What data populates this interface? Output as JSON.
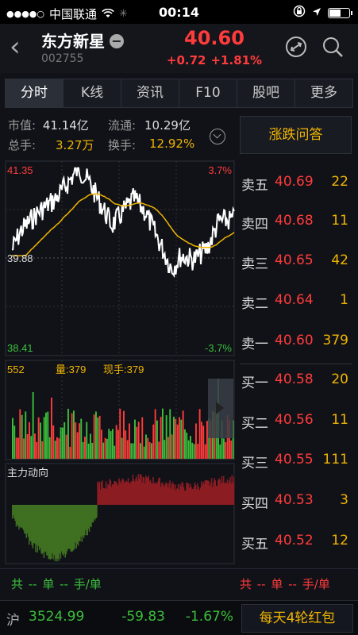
{
  "status": {
    "carrier": "中国联通",
    "time": "00:14"
  },
  "header": {
    "name": "东方新星",
    "code": "002755",
    "price": "40.60",
    "change": "+0.72",
    "change_pct": "+1.81%"
  },
  "tabs": [
    "分时",
    "K线",
    "资讯",
    "F10",
    "股吧",
    "更多"
  ],
  "info": {
    "mktcap_label": "市值:",
    "mktcap": "41.14亿",
    "float_label": "流通:",
    "float": "10.29亿",
    "vol_label": "总手:",
    "vol": "3.27万",
    "turnover_label": "换手:",
    "turnover": "12.92%"
  },
  "zdwd_label": "涨跌问答",
  "chart_labels": {
    "high": "41.35",
    "high_pct": "3.7%",
    "prev_close": "39.88",
    "low": "38.41",
    "low_pct": "-3.7%",
    "vol_max": "552",
    "vol_text": "量:379",
    "now_text": "现手:379",
    "main_flow": "主力动向"
  },
  "orderbook": {
    "asks": [
      {
        "label": "卖五",
        "price": "40.69",
        "vol": "22"
      },
      {
        "label": "卖四",
        "price": "40.68",
        "vol": "11"
      },
      {
        "label": "卖三",
        "price": "40.65",
        "vol": "42"
      },
      {
        "label": "卖二",
        "price": "40.64",
        "vol": "1"
      },
      {
        "label": "卖一",
        "price": "40.60",
        "vol": "379"
      }
    ],
    "bids": [
      {
        "label": "买一",
        "price": "40.58",
        "vol": "20"
      },
      {
        "label": "买二",
        "price": "40.56",
        "vol": "11"
      },
      {
        "label": "买三",
        "price": "40.55",
        "vol": "111"
      },
      {
        "label": "买四",
        "price": "40.53",
        "vol": "3"
      },
      {
        "label": "买五",
        "price": "40.52",
        "vol": "12"
      }
    ]
  },
  "summary": {
    "left": "共 -- 单  -- 手/单",
    "right": "共 -- 单  -- 手/单"
  },
  "index": {
    "market": "沪",
    "value": "3524.99",
    "change": "-59.83",
    "pct": "-1.67%",
    "promo": "每天4轮红包"
  },
  "colors": {
    "up": "#ff3b3b",
    "down": "#3bbf3b",
    "accent": "#f0b400",
    "avg": "#f0b400"
  }
}
